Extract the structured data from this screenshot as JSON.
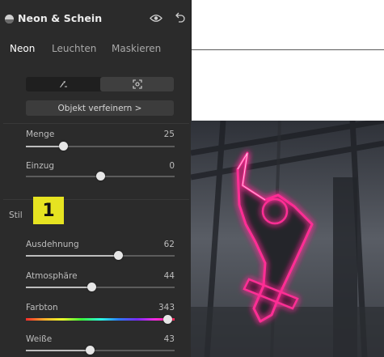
{
  "panel": {
    "title": "Neon & Schein",
    "tabs": [
      {
        "label": "Neon",
        "active": true
      },
      {
        "label": "Leuchten",
        "active": false
      },
      {
        "label": "Maskieren",
        "active": false
      }
    ],
    "refine_label": "Objekt verfeinern  >",
    "stil_label": "Stil",
    "badge": "1",
    "sliders": {
      "menge": {
        "label": "Menge",
        "value": "25",
        "level": 0.25
      },
      "einzug": {
        "label": "Einzug",
        "value": "0",
        "level": 0.5
      },
      "ausdehnung": {
        "label": "Ausdehnung",
        "value": "62",
        "level": 0.62
      },
      "atmosphaere": {
        "label": "Atmosphäre",
        "value": "44",
        "level": 0.44
      },
      "farbton": {
        "label": "Farbton",
        "value": "343",
        "level": 0.95
      },
      "weisse": {
        "label": "Weiße",
        "value": "43",
        "level": 0.43
      }
    }
  },
  "icons": {
    "title": "globe-icon",
    "visibility": "eye-icon",
    "undo": "undo-icon",
    "mode_left": "brush-icon",
    "mode_right": "object-select-icon"
  },
  "colors": {
    "panel_bg": "#2b2b2b",
    "badge_bg": "#e6e321",
    "neon": "#ff2d95"
  }
}
